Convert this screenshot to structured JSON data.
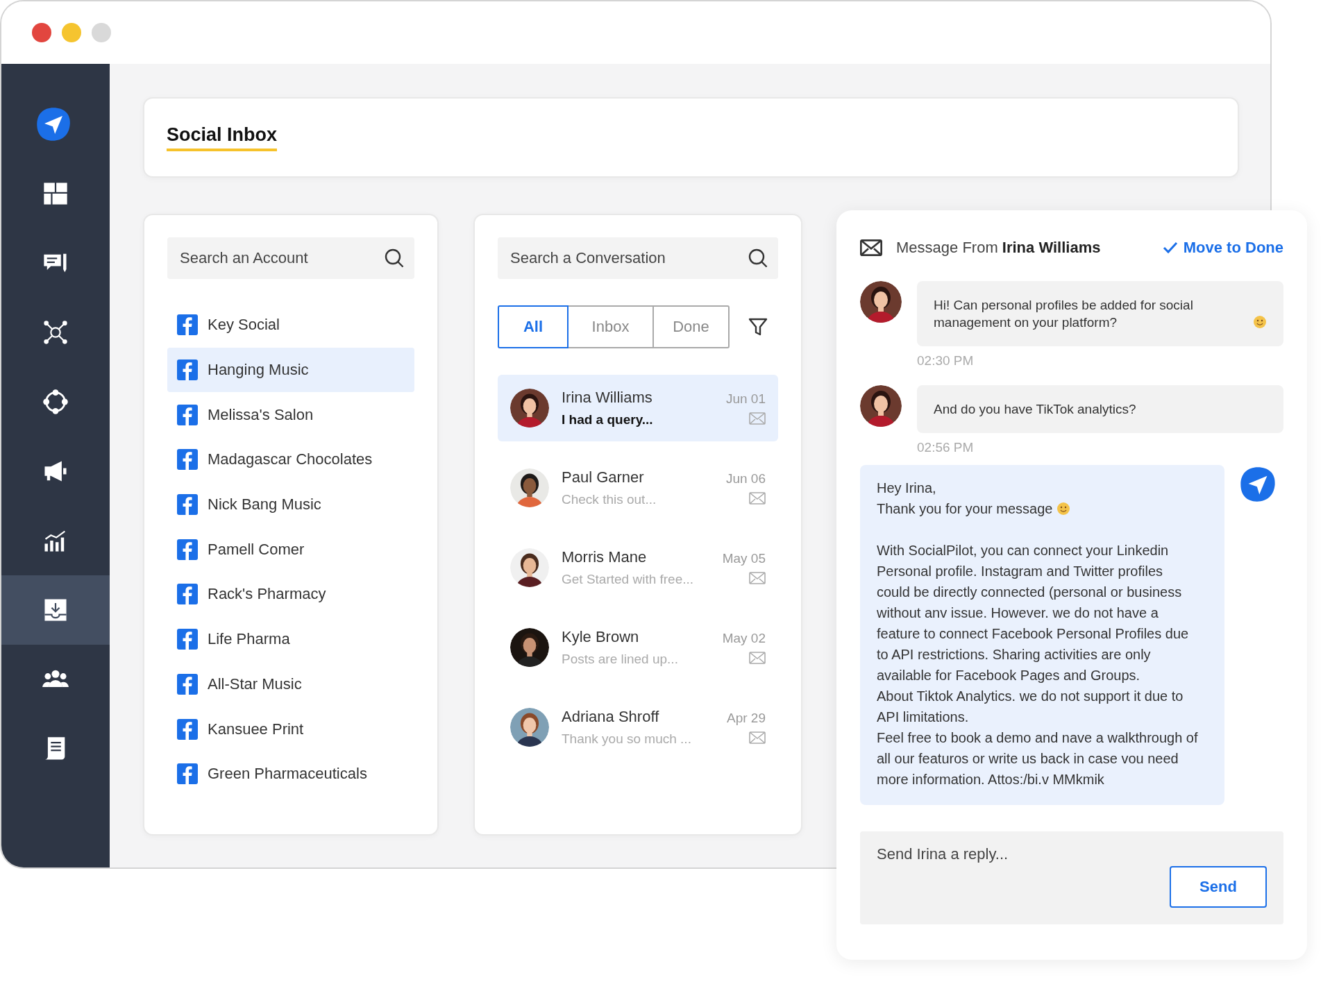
{
  "window": {
    "controls": [
      {
        "kind": "close"
      },
      {
        "kind": "minimize"
      },
      {
        "kind": "zoom"
      }
    ]
  },
  "sidebar": {
    "items": [
      {
        "kind": "dashboard",
        "selected": false
      },
      {
        "kind": "compose",
        "selected": false
      },
      {
        "kind": "network",
        "selected": false
      },
      {
        "kind": "connect",
        "selected": false
      },
      {
        "kind": "megaphone",
        "selected": false
      },
      {
        "kind": "analytics",
        "selected": false
      },
      {
        "kind": "inbox",
        "selected": true
      },
      {
        "kind": "team",
        "selected": false
      },
      {
        "kind": "report",
        "selected": false
      }
    ]
  },
  "header": {
    "title": "Social Inbox"
  },
  "accounts": {
    "search": {
      "placeholder": "Search an Account"
    },
    "items": [
      {
        "name": "Key Social",
        "selected": false
      },
      {
        "name": "Hanging Music",
        "selected": true
      },
      {
        "name": "Melissa's Salon",
        "selected": false
      },
      {
        "name": "Madagascar Chocolates",
        "selected": false
      },
      {
        "name": "Nick Bang Music",
        "selected": false
      },
      {
        "name": "Pamell Comer",
        "selected": false
      },
      {
        "name": "Rack's Pharmacy",
        "selected": false
      },
      {
        "name": "Life Pharma",
        "selected": false
      },
      {
        "name": "All-Star Music",
        "selected": false
      },
      {
        "name": "Kansuee Print",
        "selected": false
      },
      {
        "name": "Green Pharmaceuticals",
        "selected": false
      }
    ]
  },
  "conversations": {
    "search": {
      "placeholder": "Search a Conversation"
    },
    "tabs": [
      {
        "label": "All",
        "selected": true
      },
      {
        "label": "Inbox",
        "selected": false
      },
      {
        "label": "Done",
        "selected": false
      }
    ],
    "items": [
      {
        "name": "Irina Williams",
        "preview": "I had a query...",
        "date": "Jun 01",
        "selected": true,
        "unread": true
      },
      {
        "name": "Paul Garner",
        "preview": "Check this out...",
        "date": "Jun 06",
        "selected": false,
        "unread": false
      },
      {
        "name": "Morris Mane",
        "preview": "Get Started with free...",
        "date": "May 05",
        "selected": false,
        "unread": false
      },
      {
        "name": "Kyle Brown",
        "preview": "Posts are lined up...",
        "date": "May 02",
        "selected": false,
        "unread": false
      },
      {
        "name": "Adriana Shroff",
        "preview": "Thank you so much ...",
        "date": "Apr 29",
        "selected": false,
        "unread": false
      }
    ]
  },
  "message_panel": {
    "title": "Message From **Irina Williams**",
    "action": "Move to Done",
    "messages": [
      {
        "kind": "incoming",
        "text": "Hi! Can personal profiles be added for social management on your platform?",
        "emoji": true,
        "time": "02:30 PM"
      },
      {
        "kind": "incoming",
        "text": "And do you have TikTok analytics?",
        "emoji": false,
        "time": "02:56 PM"
      },
      {
        "kind": "outgoing",
        "greeting": [
          {
            "text": "Hey Irina,",
            "emoji": false
          },
          {
            "text": "Thank you for your message",
            "emoji": true
          }
        ],
        "body": [
          "With SocialPilot, you can connect your Linkedin Personal profile. Instagram and Twitter profiles could be directly connected (personal or business without anv issue. However. we do not have a feature to connect Facebook Personal Profiles due to API restrictions. Sharing activities are only available for Facebook Pages and Groups.",
          "About Tiktok Analytics. we do not support it due to API limitations.",
          "Feel free to book a demo and nave a walkthrough of all our featuros or write us back in case vou need more information. Attos:/bi.v MMkmik"
        ]
      }
    ],
    "reply": {
      "placeholder": "Send Irina a reply...",
      "button": "Send"
    }
  }
}
